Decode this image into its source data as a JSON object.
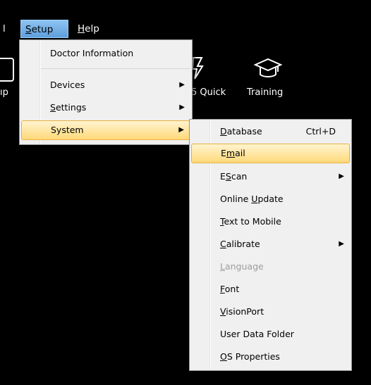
{
  "menubar": {
    "tools_partial": "l",
    "setup": {
      "prefix": "",
      "underline": "S",
      "rest": "etup"
    },
    "help": {
      "prefix": "",
      "underline": "H",
      "rest": "elp"
    }
  },
  "toolbar": {
    "left_partial": "ıp",
    "quick_label": "5 Quick",
    "training_label": "Training"
  },
  "setup_menu": {
    "doctor_information": "Doctor Information",
    "devices": "Devices",
    "settings": {
      "prefix": "",
      "underline": "S",
      "rest": "ettings"
    },
    "system": "System"
  },
  "system_menu": {
    "database": {
      "prefix": "",
      "underline": "D",
      "rest": "atabase",
      "shortcut": "Ctrl+D"
    },
    "email": {
      "prefix": "E",
      "underline": "m",
      "rest": "ail"
    },
    "escan": {
      "prefix": "E",
      "underline": "S",
      "rest": "can"
    },
    "online_update": {
      "prefix": "Online ",
      "underline": "U",
      "rest": "pdate"
    },
    "text_to_mobile": {
      "prefix": "",
      "underline": "T",
      "rest": "ext to Mobile"
    },
    "calibrate": {
      "prefix": "",
      "underline": "C",
      "rest": "alibrate"
    },
    "language": {
      "prefix": "",
      "underline": "L",
      "rest": "anguage"
    },
    "font": {
      "prefix": "",
      "underline": "F",
      "rest": "ont"
    },
    "visionport": {
      "prefix": "",
      "underline": "V",
      "rest": "isionPort"
    },
    "user_data_folder": "User Data Folder",
    "os_properties": {
      "prefix": "",
      "underline": "O",
      "rest": "S Properties"
    }
  },
  "icons": [
    "device-icon",
    "lightning-icon",
    "graduation-cap-icon",
    "submenu-arrow-icon"
  ],
  "colors": {
    "highlight_start": "#fff4d0",
    "highlight_end": "#ffd97a",
    "menubar_active": "#7fb6ea",
    "background": "#000000"
  }
}
